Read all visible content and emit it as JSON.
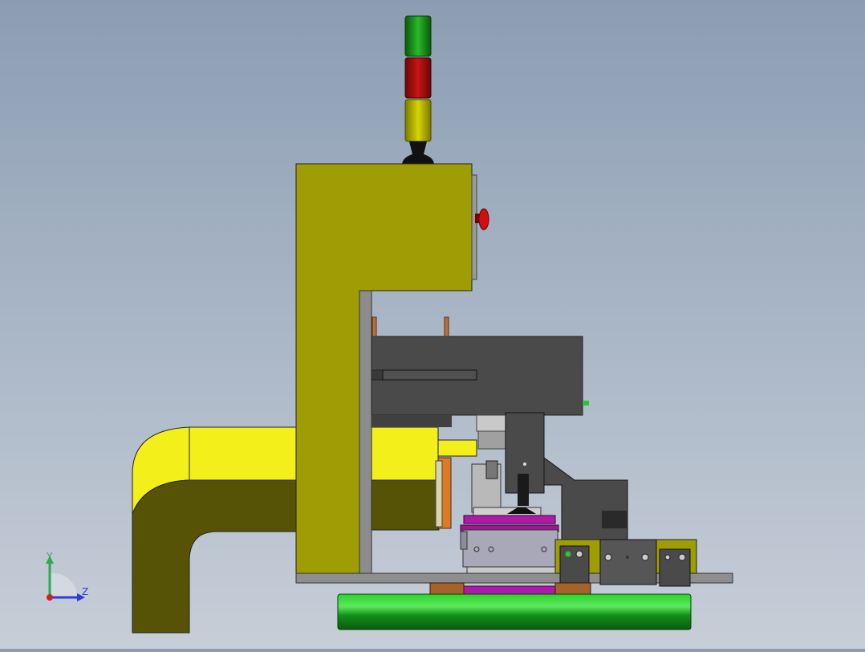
{
  "app": {
    "window_title": ""
  },
  "triad": {
    "y_label": "Y",
    "z_label": "Z",
    "colors": {
      "y": "#2fa84f",
      "z": "#2b3fd6",
      "origin": "#d02020"
    }
  },
  "model": {
    "colors": {
      "frame_yellow": "#9e9d04",
      "bright_yellow": "#f2ef1a",
      "olive_dark": "#565306",
      "gray_dark": "#4a4a4a",
      "gray_mid": "#8c8c8c",
      "magenta": "#b01aa8",
      "green": "#1aa21a",
      "copper": "#a5622a",
      "red": "#c01010"
    },
    "signal_tower": [
      "green",
      "red",
      "yellow"
    ],
    "emergency_stop": "red-mushroom-button"
  }
}
